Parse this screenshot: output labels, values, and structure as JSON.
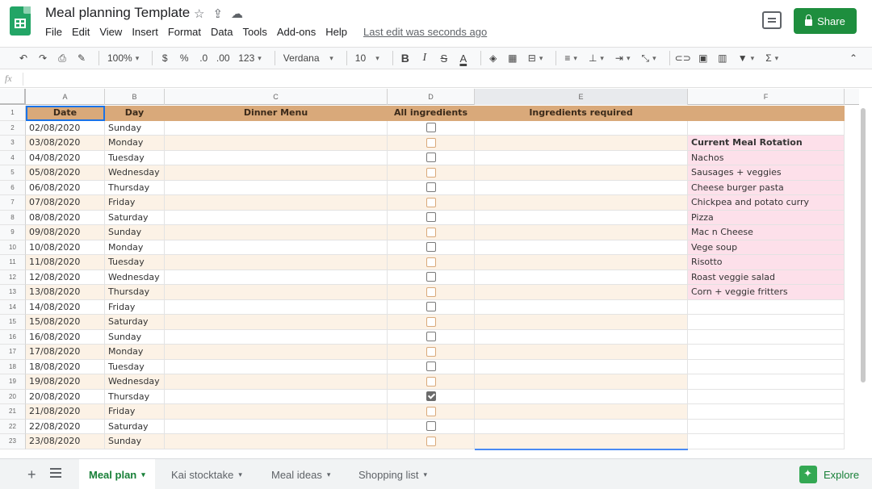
{
  "doc": {
    "title": "Meal planning Template",
    "last_edit": "Last edit was seconds ago"
  },
  "menu": [
    "File",
    "Edit",
    "View",
    "Insert",
    "Format",
    "Data",
    "Tools",
    "Add-ons",
    "Help"
  ],
  "share": {
    "label": "Share"
  },
  "toolbar": {
    "zoom": "100%",
    "currency": "$",
    "percent": "%",
    "decimal_less": ".0",
    "decimal_more": ".00",
    "more_formats": "123",
    "font": "Verdana",
    "font_size": "10",
    "bold": "B",
    "italic": "I",
    "strike": "S",
    "text_color": "A"
  },
  "formula": {
    "fx": "fx"
  },
  "columns": [
    "A",
    "B",
    "C",
    "D",
    "E",
    "F"
  ],
  "headers": {
    "date": "Date",
    "day": "Day",
    "dinner_menu": "Dinner Menu",
    "all_ingredients": "All ingredients",
    "ingredients_required": "Ingredients required"
  },
  "rows": [
    {
      "num": "2",
      "date": "02/08/2020",
      "day": "Sunday",
      "checked": false
    },
    {
      "num": "3",
      "date": "03/08/2020",
      "day": "Monday",
      "checked": false
    },
    {
      "num": "4",
      "date": "04/08/2020",
      "day": "Tuesday",
      "checked": false
    },
    {
      "num": "5",
      "date": "05/08/2020",
      "day": "Wednesday",
      "checked": false
    },
    {
      "num": "6",
      "date": "06/08/2020",
      "day": "Thursday",
      "checked": false
    },
    {
      "num": "7",
      "date": "07/08/2020",
      "day": "Friday",
      "checked": false
    },
    {
      "num": "8",
      "date": "08/08/2020",
      "day": "Saturday",
      "checked": false
    },
    {
      "num": "9",
      "date": "09/08/2020",
      "day": "Sunday",
      "checked": false
    },
    {
      "num": "10",
      "date": "10/08/2020",
      "day": "Monday",
      "checked": false
    },
    {
      "num": "11",
      "date": "11/08/2020",
      "day": "Tuesday",
      "checked": false
    },
    {
      "num": "12",
      "date": "12/08/2020",
      "day": "Wednesday",
      "checked": false
    },
    {
      "num": "13",
      "date": "13/08/2020",
      "day": "Thursday",
      "checked": false
    },
    {
      "num": "14",
      "date": "14/08/2020",
      "day": "Friday",
      "checked": false
    },
    {
      "num": "15",
      "date": "15/08/2020",
      "day": "Saturday",
      "checked": false
    },
    {
      "num": "16",
      "date": "16/08/2020",
      "day": "Sunday",
      "checked": false
    },
    {
      "num": "17",
      "date": "17/08/2020",
      "day": "Monday",
      "checked": false
    },
    {
      "num": "18",
      "date": "18/08/2020",
      "day": "Tuesday",
      "checked": false
    },
    {
      "num": "19",
      "date": "19/08/2020",
      "day": "Wednesday",
      "checked": false
    },
    {
      "num": "20",
      "date": "20/08/2020",
      "day": "Thursday",
      "checked": true
    },
    {
      "num": "21",
      "date": "21/08/2020",
      "day": "Friday",
      "checked": false
    },
    {
      "num": "22",
      "date": "22/08/2020",
      "day": "Saturday",
      "checked": false
    },
    {
      "num": "23",
      "date": "23/08/2020",
      "day": "Sunday",
      "checked": false
    }
  ],
  "rotation": {
    "title": "Current Meal Rotation",
    "items": [
      "Nachos",
      "Sausages + veggies",
      "Cheese burger pasta",
      "Chickpea and potato curry",
      "Pizza",
      "Mac n Cheese",
      "Vege soup",
      "Risotto",
      "Roast veggie salad",
      "Corn + veggie fritters"
    ]
  },
  "sheets": [
    {
      "name": "Meal plan",
      "active": true
    },
    {
      "name": "Kai stocktake",
      "active": false
    },
    {
      "name": "Meal ideas",
      "active": false
    },
    {
      "name": "Shopping list",
      "active": false
    }
  ],
  "explore": {
    "label": "Explore"
  },
  "colors": {
    "header_fill": "#d9a97a",
    "band_fill": "#fcf2e6",
    "rotation_fill": "#fde0ea",
    "accent": "#1e8e3e"
  }
}
